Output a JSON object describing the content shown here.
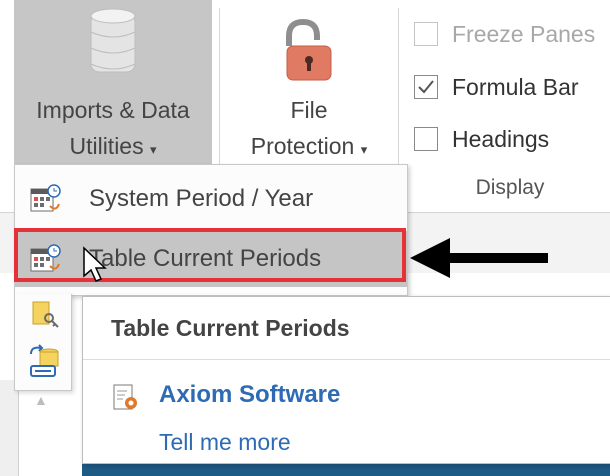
{
  "ribbon": {
    "imports": {
      "line1": "Imports & Data",
      "line2": "Utilities",
      "icon": "database-icon"
    },
    "file": {
      "line1": "File",
      "line2": "Protection",
      "icon": "padlock-icon"
    },
    "display": {
      "freeze_panes": {
        "label": "Freeze Panes",
        "checked": false,
        "enabled": false
      },
      "formula_bar": {
        "label": "Formula Bar",
        "checked": true,
        "enabled": true
      },
      "headings": {
        "label": "Headings",
        "checked": false,
        "enabled": true
      },
      "group_label": "Display"
    }
  },
  "menu": {
    "items": [
      {
        "label": "System Period / Year",
        "icon": "calendar-clock-icon"
      },
      {
        "label": "Table Current Periods",
        "icon": "calendar-clock-icon",
        "highlighted": true
      }
    ],
    "extra_icons": [
      "key-document-icon",
      "database-refresh-icon"
    ]
  },
  "tooltip": {
    "title": "Table Current Periods",
    "brand": "Axiom Software",
    "link": "Tell me more"
  },
  "colors": {
    "highlight_border": "#e53238",
    "link_blue": "#2e6bb4",
    "hover_gray": "#c5c5c5"
  }
}
